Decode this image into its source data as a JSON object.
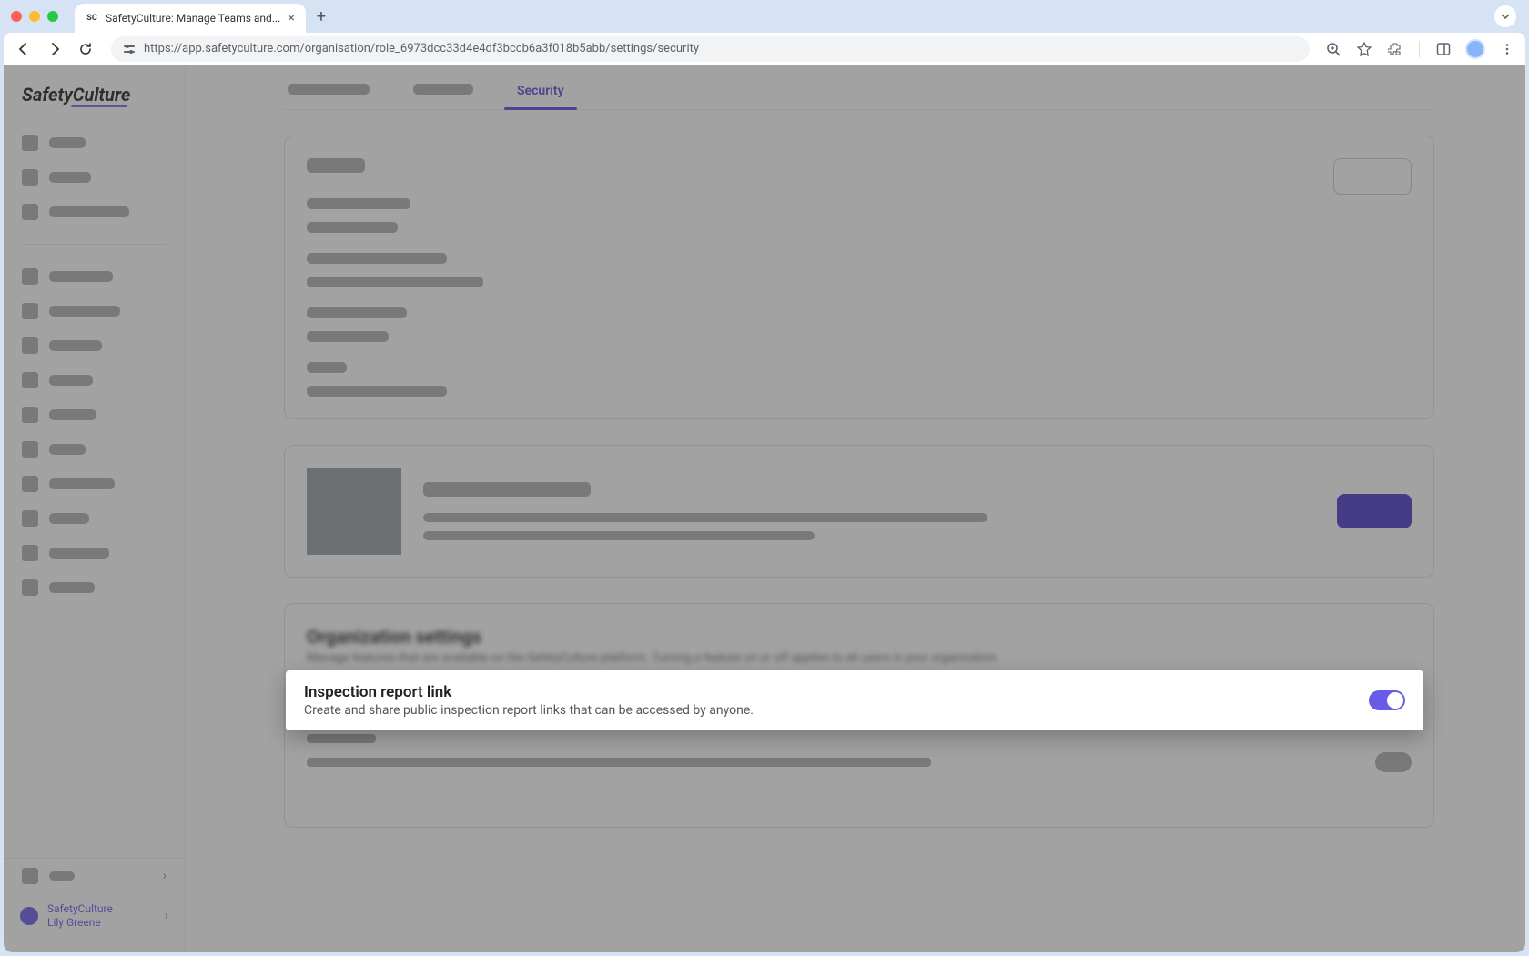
{
  "browser": {
    "tab_title": "SafetyCulture: Manage Teams and...",
    "favicon_text": "SC",
    "url": "https://app.safetyculture.com/organisation/role_6973dcc33d4e4df3bccb6a3f018b5abb/settings/security"
  },
  "app": {
    "logo": "SafetyCulture",
    "tabs": {
      "active_label": "Security"
    },
    "org_section": {
      "title": "Organization settings",
      "subtitle": "Manage features that are available on the SafetyCulture platform. Turning a feature on or off applies to all users in your organization."
    },
    "highlight": {
      "title": "Inspection report link",
      "description": "Create and share public inspection report links that can be accessed by anyone.",
      "toggle_on": true
    },
    "user": {
      "org": "SafetyCulture",
      "name": "Lily Greene"
    }
  }
}
